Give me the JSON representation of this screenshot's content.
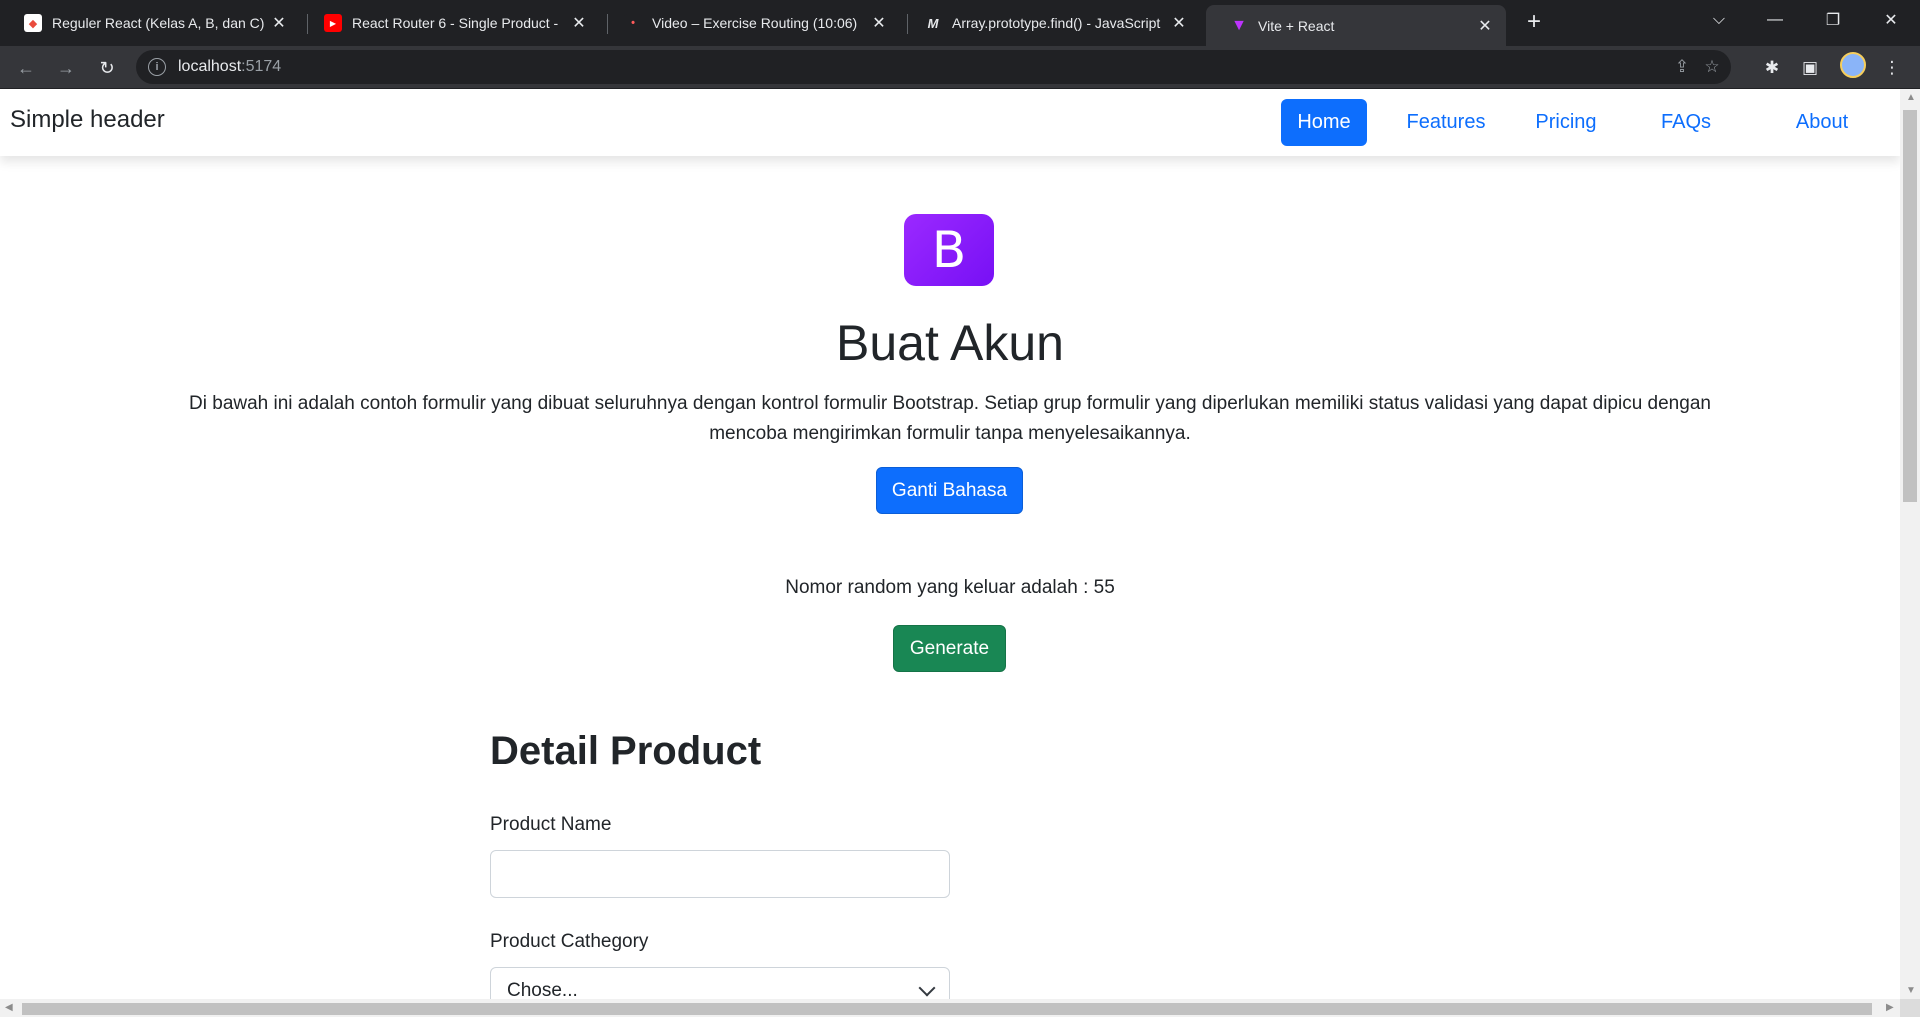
{
  "browser": {
    "tabs": [
      {
        "title": "Reguler React (Kelas A, B, dan C)",
        "icon": "alterra-icon"
      },
      {
        "title": "React Router 6 - Single Product -",
        "icon": "youtube-icon"
      },
      {
        "title": "Video – Exercise Routing (10:06)",
        "icon": "video-icon"
      },
      {
        "title": "Array.prototype.find() - JavaScript",
        "icon": "mdn-icon"
      },
      {
        "title": "Vite + React",
        "icon": "vite-icon"
      }
    ],
    "close_glyph": "✕",
    "new_tab_glyph": "+",
    "url_host": "localhost",
    "url_port": ":5174",
    "url_info_glyph": "i"
  },
  "header": {
    "brand": "Simple header",
    "nav": [
      "Home",
      "Features",
      "Pricing",
      "FAQs",
      "About"
    ],
    "active": "Home"
  },
  "hero": {
    "logo_letter": "B",
    "title": "Buat Akun",
    "description": "Di bawah ini adalah contoh formulir yang dibuat seluruhnya dengan kontrol formulir Bootstrap. Setiap grup formulir yang diperlukan memiliki status validasi yang dapat dipicu dengan mencoba mengirimkan formulir tanpa menyelesaikannya.",
    "language_button": "Ganti Bahasa"
  },
  "random": {
    "text": "Nomor random yang keluar adalah : 55",
    "generate_button": "Generate"
  },
  "form": {
    "section_title": "Detail Product",
    "product_name_label": "Product Name",
    "product_name_value": "",
    "category_label": "Product Cathegory",
    "category_selected": "Chose..."
  },
  "colors": {
    "primary": "#0d6efd",
    "success": "#198754",
    "bootstrap_purple": "#7952b3",
    "browser_dark": "#202124"
  }
}
